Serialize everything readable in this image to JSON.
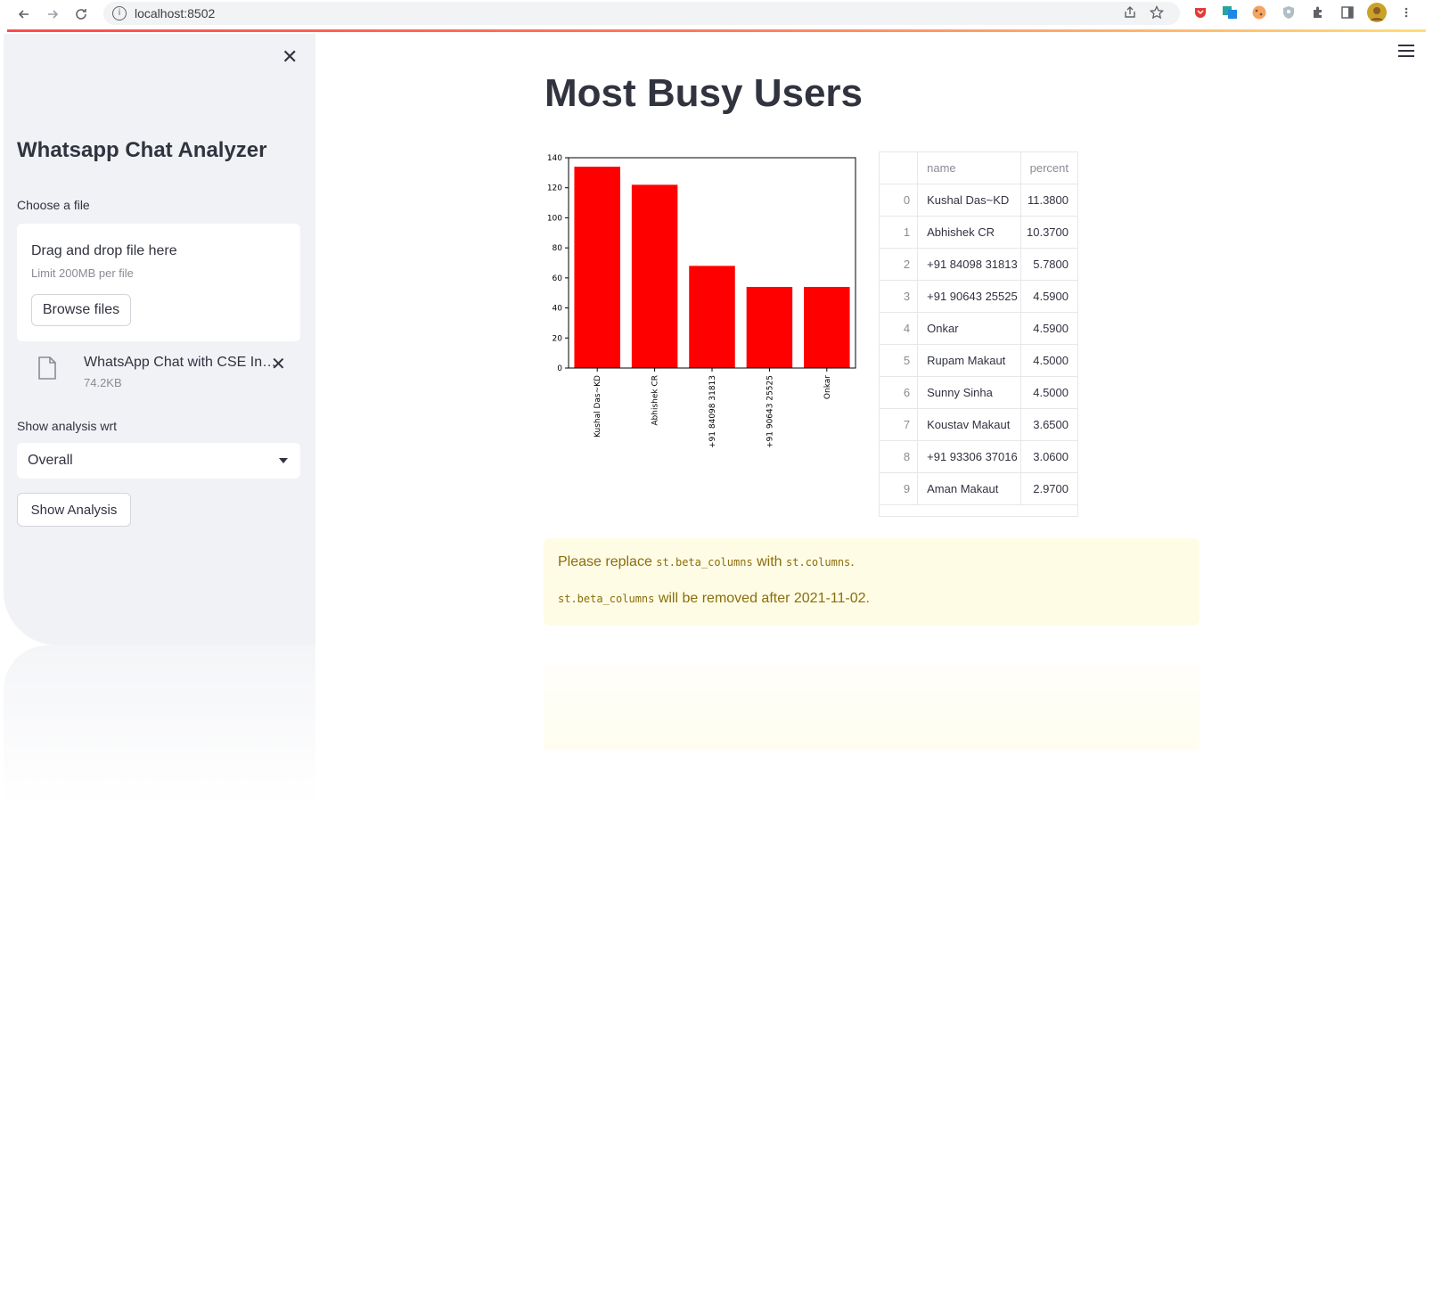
{
  "browser": {
    "url": "localhost:8502"
  },
  "sidebar": {
    "title": "Whatsapp Chat Analyzer",
    "file_label": "Choose a file",
    "dropzone_text": "Drag and drop file here",
    "dropzone_limit": "Limit 200MB per file",
    "browse_label": "Browse files",
    "uploaded_file_name": "WhatsApp Chat with CSE In…",
    "uploaded_file_size": "74.2KB",
    "analysis_label": "Show analysis wrt",
    "analysis_selected": "Overall",
    "show_button": "Show Analysis"
  },
  "main": {
    "title": "Most Busy Users",
    "table": {
      "columns": [
        "",
        "name",
        "percent"
      ],
      "rows": [
        [
          "0",
          "Kushal Das~KD",
          "11.3800"
        ],
        [
          "1",
          "Abhishek CR",
          "10.3700"
        ],
        [
          "2",
          "+91 84098 31813",
          "5.7800"
        ],
        [
          "3",
          "+91 90643 25525",
          "4.5900"
        ],
        [
          "4",
          "Onkar",
          "4.5900"
        ],
        [
          "5",
          "Rupam Makaut",
          "4.5000"
        ],
        [
          "6",
          "Sunny Sinha",
          "4.5000"
        ],
        [
          "7",
          "Koustav Makaut",
          "3.6500"
        ],
        [
          "8",
          "+91 93306 37016",
          "3.0600"
        ],
        [
          "9",
          "Aman Makaut",
          "2.9700"
        ]
      ]
    },
    "warning": {
      "p1_pre": "Please replace ",
      "p1_code1": "st.beta_columns",
      "p1_mid": " with ",
      "p1_code2": "st.columns",
      "p1_post": ".",
      "p2_code": "st.beta_columns",
      "p2_post": " will be removed after 2021-11-02."
    }
  },
  "chart_data": {
    "type": "bar",
    "categories": [
      "Kushal Das~KD",
      "Abhishek CR",
      "+91 84098 31813",
      "+91 90643 25525",
      "Onkar"
    ],
    "values": [
      134,
      122,
      68,
      54,
      54
    ],
    "ylim": [
      0,
      140
    ],
    "yticks": [
      0,
      20,
      40,
      60,
      80,
      100,
      120,
      140
    ],
    "bar_color": "#ff0000",
    "grid": false
  },
  "colors": {
    "sidebar_bg": "#f0f2f6",
    "warning_bg": "#fffce6",
    "warning_text": "#8a6d0b",
    "accent": "#ff4b4b"
  }
}
